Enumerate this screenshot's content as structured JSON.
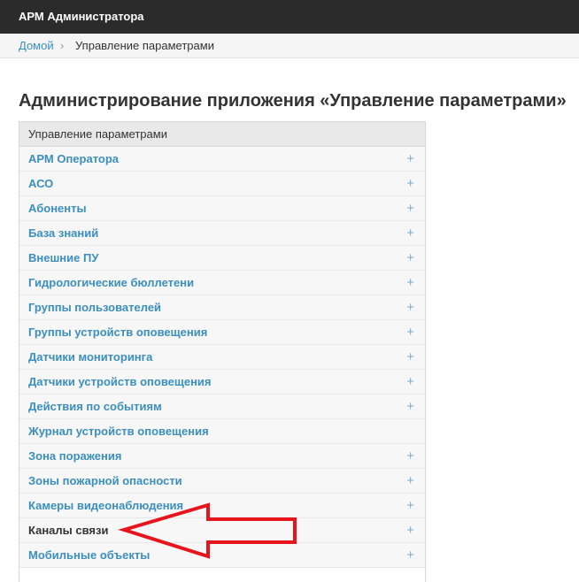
{
  "header": {
    "title": "АРМ Администратора"
  },
  "breadcrumb": {
    "home": "Домой",
    "separator": "›",
    "current": "Управление параметрами"
  },
  "page": {
    "title": "Администрирование приложения «Управление параметрами»"
  },
  "module": {
    "caption": "Управление параметрами",
    "add_symbol": "+",
    "items": [
      {
        "label": "АРМ Оператора",
        "add": true
      },
      {
        "label": "АСО",
        "add": true
      },
      {
        "label": "Абоненты",
        "add": true
      },
      {
        "label": "База знаний",
        "add": true
      },
      {
        "label": "Внешние ПУ",
        "add": true
      },
      {
        "label": "Гидрологические бюллетени",
        "add": true
      },
      {
        "label": "Группы пользователей",
        "add": true
      },
      {
        "label": "Группы устройств оповещения",
        "add": true
      },
      {
        "label": "Датчики мониторинга",
        "add": true
      },
      {
        "label": "Датчики устройств оповещения",
        "add": true
      },
      {
        "label": "Действия по событиям",
        "add": true
      },
      {
        "label": "Журнал устройств оповещения",
        "add": false
      },
      {
        "label": "Зона поражения",
        "add": true
      },
      {
        "label": "Зоны пожарной опасности",
        "add": true
      },
      {
        "label": "Камеры видеонаблюдения",
        "add": true
      },
      {
        "label": "Каналы связи",
        "add": true,
        "highlighted": true
      },
      {
        "label": "Мобильные объекты",
        "add": true
      }
    ]
  },
  "annotation": {
    "arrow_color": "#e8141c"
  }
}
